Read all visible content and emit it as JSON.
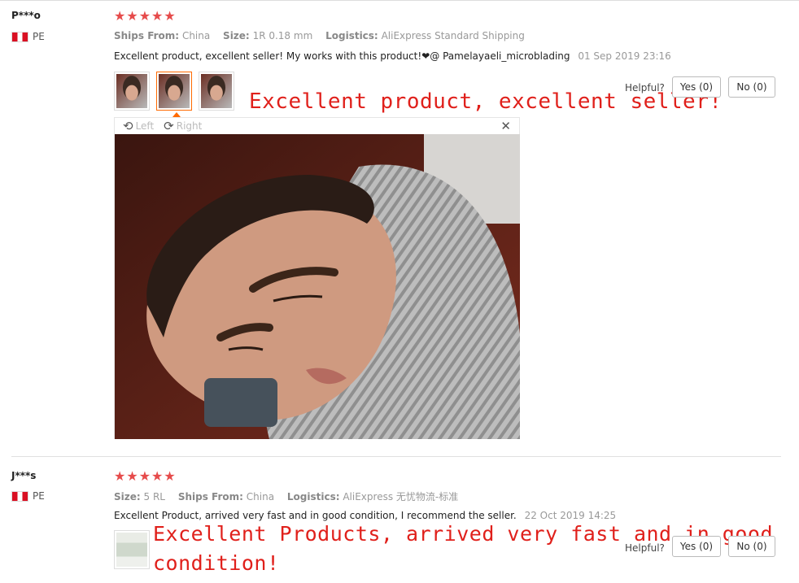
{
  "reviews": [
    {
      "user": "P***o",
      "country": "PE",
      "rating": 5,
      "meta": [
        {
          "label": "Ships From:",
          "value": "China"
        },
        {
          "label": "Size:",
          "value": "1R 0.18 mm"
        },
        {
          "label": "Logistics:",
          "value": "AliExpress Standard Shipping"
        }
      ],
      "text": "Excellent product, excellent seller! My works with this product!❤@ Pamelayaeli_microblading",
      "date": "01 Sep 2019 23:16",
      "caption": "Excellent product, excellent seller!",
      "helpful_label": "Helpful?",
      "yes_label": "Yes (0)",
      "no_label": "No (0)",
      "viewer": {
        "left_label": "Left",
        "right_label": "Right"
      }
    },
    {
      "user": "J***s",
      "country": "PE",
      "rating": 5,
      "meta": [
        {
          "label": "Size:",
          "value": "5 RL"
        },
        {
          "label": "Ships From:",
          "value": "China"
        },
        {
          "label": "Logistics:",
          "value": "AliExpress 无忧物流-标准"
        }
      ],
      "text": "Excellent Product, arrived very fast and in good condition, I recommend the seller.",
      "date": "22 Oct 2019 14:25",
      "caption_line1": "Excellent Products, arrived very fast and in good",
      "caption_line2": "condition!",
      "helpful_label": "Helpful?",
      "yes_label": "Yes (0)",
      "no_label": "No (0)"
    }
  ],
  "icons": {
    "star": "star-icon",
    "rotate_left": "rotate-left-icon",
    "rotate_right": "rotate-right-icon",
    "close": "close-icon",
    "flag": "peru-flag-icon"
  },
  "colors": {
    "star": "#e64b4b",
    "caption": "#e0201b",
    "active_thumb": "#ff6a00"
  }
}
